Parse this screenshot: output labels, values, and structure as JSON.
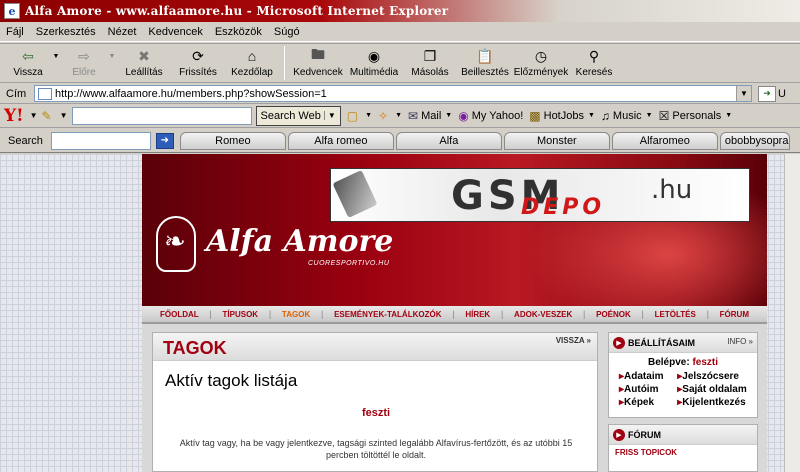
{
  "window": {
    "title": "Alfa Amore - www.alfaamore.hu - Microsoft Internet Explorer"
  },
  "menu": [
    "Fájl",
    "Szerkesztés",
    "Nézet",
    "Kedvencek",
    "Eszközök",
    "Súgó"
  ],
  "toolbar": {
    "back": "Vissza",
    "forward": "Előre",
    "stop": "Leállítás",
    "refresh": "Frissítés",
    "home": "Kezdőlap",
    "favorites": "Kedvencek",
    "multimedia": "Multimédia",
    "copy": "Másolás",
    "paste": "Beillesztés",
    "history": "Előzmények",
    "search": "Keresés"
  },
  "address": {
    "label": "Cím",
    "url": "http://www.alfaamore.hu/members.php?showSession=1",
    "go_label": "U"
  },
  "yahoo": {
    "logo": "Y!",
    "search_button": "Search Web",
    "mail": "Mail",
    "myyahoo": "My Yahoo!",
    "hotjobs": "HotJobs",
    "music": "Music",
    "personals": "Personals"
  },
  "links": {
    "search_label": "Search",
    "tabs": [
      "Romeo",
      "Alfa romeo",
      "Alfa",
      "Monster",
      "Alfaromeo",
      "obobbysoprar"
    ]
  },
  "banner": {
    "gsm": "GSM",
    "depo": "DEPO",
    "domain": ".hu"
  },
  "site": {
    "logo_name": "Alfa Amore",
    "logo_sub": "CUORESPORTIVO.HU",
    "nav": [
      "FŐOLDAL",
      "TÍPUSOK",
      "TAGOK",
      "ESEMÉNYEK-TALÁLKOZÓK",
      "HÍREK",
      "ADOK-VESZEK",
      "POÉNOK",
      "LETÖLTÉS",
      "FÓRUM"
    ],
    "nav_active_index": 2
  },
  "main": {
    "title": "TAGOK",
    "back": "VISSZA »",
    "subtitle": "Aktív tagok listája",
    "user": "feszti",
    "info": "Aktív tag vagy, ha be vagy jelentkezve, tagsági szinted legalább Alfavírus-fertőzött, és az utóbbi 15 percben töltöttél le oldalt."
  },
  "settings": {
    "title": "BEÁLLÍTÁSAIM",
    "info": "INFO »",
    "logged_label": "Belépve:",
    "logged_user": "feszti",
    "links": [
      "Adataim",
      "Jelszócsere",
      "Autóim",
      "Saját oldalam",
      "Képek",
      "Kijelentkezés"
    ]
  },
  "forum": {
    "title": "FÓRUM",
    "subtitle": "FRISS TOPICOK"
  },
  "colors": {
    "brand_red": "#a00010",
    "active_nav": "#e06000"
  }
}
